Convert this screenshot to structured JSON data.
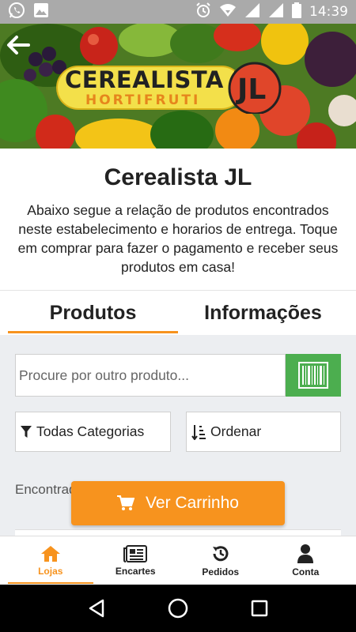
{
  "status_bar": {
    "time": "14:39",
    "icons": [
      "whatsapp-icon",
      "image-icon",
      "alarm-icon",
      "wifi-icon",
      "signal-icon",
      "signal-icon",
      "battery-icon"
    ]
  },
  "banner": {
    "logo_line1": "CEREALISTA E",
    "logo_line2": "HORTIFRUTI",
    "logo_badge": "JL"
  },
  "store": {
    "name": "Cerealista JL",
    "description": "Abaixo segue a relação de produtos encontrados neste estabelecimento e horarios de entrega. Toque em comprar para fazer o pagamento e receber seus produtos em casa!"
  },
  "tabs": [
    {
      "label": "Produtos",
      "active": true
    },
    {
      "label": "Informações",
      "active": false
    }
  ],
  "search": {
    "placeholder": "Procure por outro produto...",
    "value": ""
  },
  "filters": {
    "category_label": "Todas Categorias",
    "order_label": "Ordenar"
  },
  "results": {
    "found_text": "Encontrados"
  },
  "cart": {
    "label": "Ver Carrinho"
  },
  "bottom_nav": [
    {
      "label": "Lojas",
      "icon": "home-icon",
      "active": true
    },
    {
      "label": "Encartes",
      "icon": "newspaper-icon",
      "active": false
    },
    {
      "label": "Pedidos",
      "icon": "history-icon",
      "active": false
    },
    {
      "label": "Conta",
      "icon": "user-icon",
      "active": false
    }
  ],
  "colors": {
    "accent": "#f7931e",
    "barcode_green": "#4cae4f",
    "status_bar": "#aaaaaa",
    "content_bg": "#eceef1"
  }
}
